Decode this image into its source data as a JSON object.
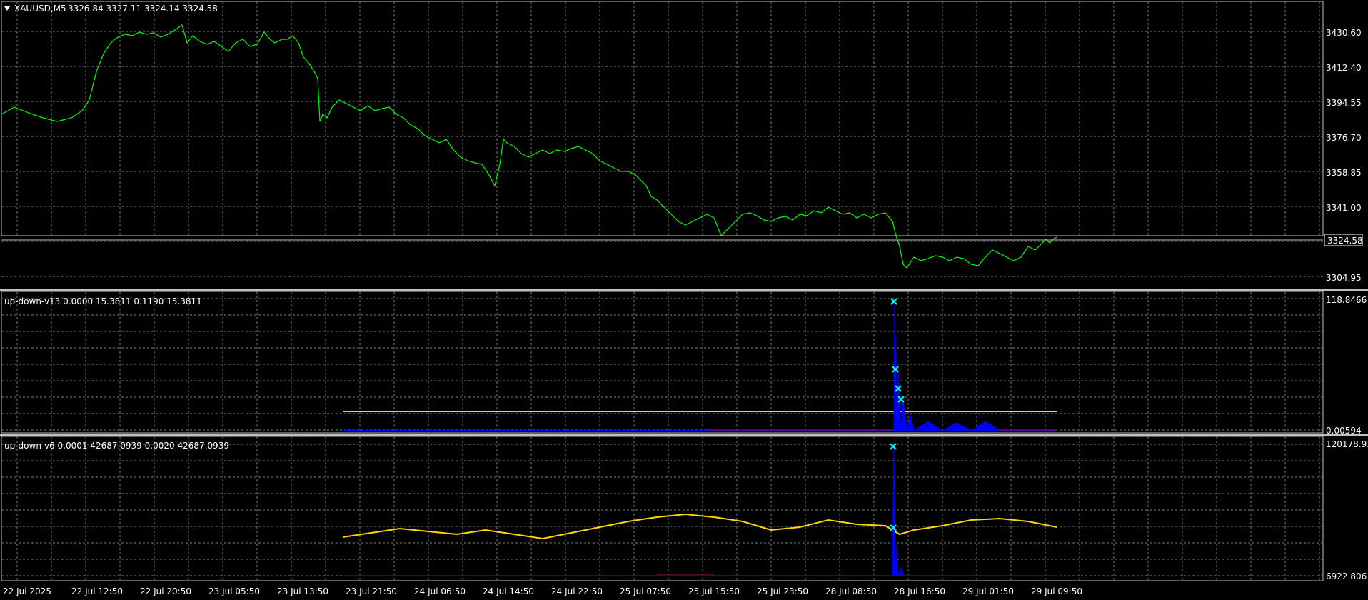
{
  "main_window": {
    "symbol_tf": "XAUUSD,M5",
    "ohlc": "3326.84 3327.11 3324.14 3324.58",
    "current_price": "3324.58",
    "price_labels": [
      "3430.60",
      "3412.40",
      "3394.55",
      "3376.70",
      "3358.85",
      "3341.00",
      "3304.95"
    ]
  },
  "subwin1": {
    "title": "up-down-v13 0.0000 15.3811 0.1190 15.3811",
    "axis_top": "118.8466",
    "axis_bottom": "0.00594"
  },
  "subwin2": {
    "title": "up-down-v6 0.0001 42687.0939 0.0020 42687.0939",
    "axis_top": "120178.93",
    "axis_bottom": "6922.806"
  },
  "time_axis": [
    "22 Jul 2025",
    "22 Jul 12:50",
    "22 Jul 20:50",
    "23 Jul 05:50",
    "23 Jul 13:50",
    "23 Jul 21:50",
    "24 Jul 06:50",
    "24 Jul 14:50",
    "24 Jul 22:50",
    "25 Jul 07:50",
    "25 Jul 15:50",
    "25 Jul 23:50",
    "28 Jul 08:50",
    "28 Jul 16:50",
    "29 Jul 01:50",
    "29 Jul 09:50"
  ],
  "colors": {
    "background": "#000000",
    "grid": "#7f7f7f",
    "frame": "#bfbfbf",
    "price_line": "#00ff00",
    "indicator_yellow": "#ffd700",
    "indicator_blue": "#0000ff",
    "indicator_cross": "#00ffff",
    "indicator_dark_red": "#a01050"
  }
}
